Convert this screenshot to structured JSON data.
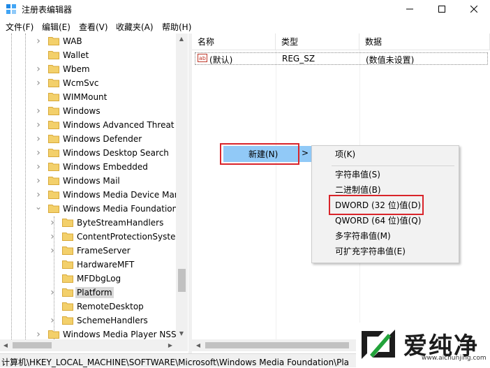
{
  "window": {
    "title": "注册表编辑器",
    "icon": "regedit-icon"
  },
  "menu": [
    "文件(F)",
    "编辑(E)",
    "查看(V)",
    "收藏夹(A)",
    "帮助(H)"
  ],
  "tree": {
    "items": [
      {
        "label": "WAB",
        "expand": true
      },
      {
        "label": "Wallet",
        "expand": false
      },
      {
        "label": "Wbem",
        "expand": true
      },
      {
        "label": "WcmSvc",
        "expand": true
      },
      {
        "label": "WIMMount",
        "expand": false
      },
      {
        "label": "Windows",
        "expand": true
      },
      {
        "label": "Windows Advanced Threat P",
        "expand": true
      },
      {
        "label": "Windows Defender",
        "expand": true
      },
      {
        "label": "Windows Desktop Search",
        "expand": true
      },
      {
        "label": "Windows Embedded",
        "expand": true
      },
      {
        "label": "Windows Mail",
        "expand": true
      },
      {
        "label": "Windows Media Device Man",
        "expand": true
      },
      {
        "label": "Windows Media Foundation",
        "expand": "open"
      },
      {
        "label": "ByteStreamHandlers",
        "expand": true,
        "child": true
      },
      {
        "label": "ContentProtectionSystem",
        "expand": true,
        "child": true
      },
      {
        "label": "FrameServer",
        "expand": true,
        "child": true
      },
      {
        "label": "HardwareMFT",
        "expand": false,
        "child": true
      },
      {
        "label": "MFDbgLog",
        "expand": false,
        "child": true
      },
      {
        "label": "Platform",
        "expand": true,
        "child": true,
        "selected": true
      },
      {
        "label": "RemoteDesktop",
        "expand": false,
        "child": true
      },
      {
        "label": "SchemeHandlers",
        "expand": true,
        "child": true
      },
      {
        "label": "Windows Media Player NSS",
        "expand": true
      }
    ]
  },
  "list": {
    "columns": [
      "名称",
      "类型",
      "数据"
    ],
    "rows": [
      {
        "name": "(默认)",
        "type": "REG_SZ",
        "data": "(数值未设置)"
      }
    ]
  },
  "context_menu": {
    "new_label": "新建(N)",
    "submenu_arrow": ">",
    "submenu": [
      "项(K)",
      "字符串值(S)",
      "二进制值(B)",
      "DWORD (32 位)值(D)",
      "QWORD (64 位)值(Q)",
      "多字符串值(M)",
      "可扩充字符串值(E)"
    ]
  },
  "status": {
    "path": "计算机\\HKEY_LOCAL_MACHINE\\SOFTWARE\\Microsoft\\Windows Media Foundation\\Pla"
  },
  "watermark": {
    "brand": "爱纯净",
    "url": "www.aichunjing.com"
  },
  "colors": {
    "highlight": "#91c9f7",
    "callout_red": "#d9242a",
    "folder": "#f3d06b",
    "logo_green": "#22a33a"
  }
}
